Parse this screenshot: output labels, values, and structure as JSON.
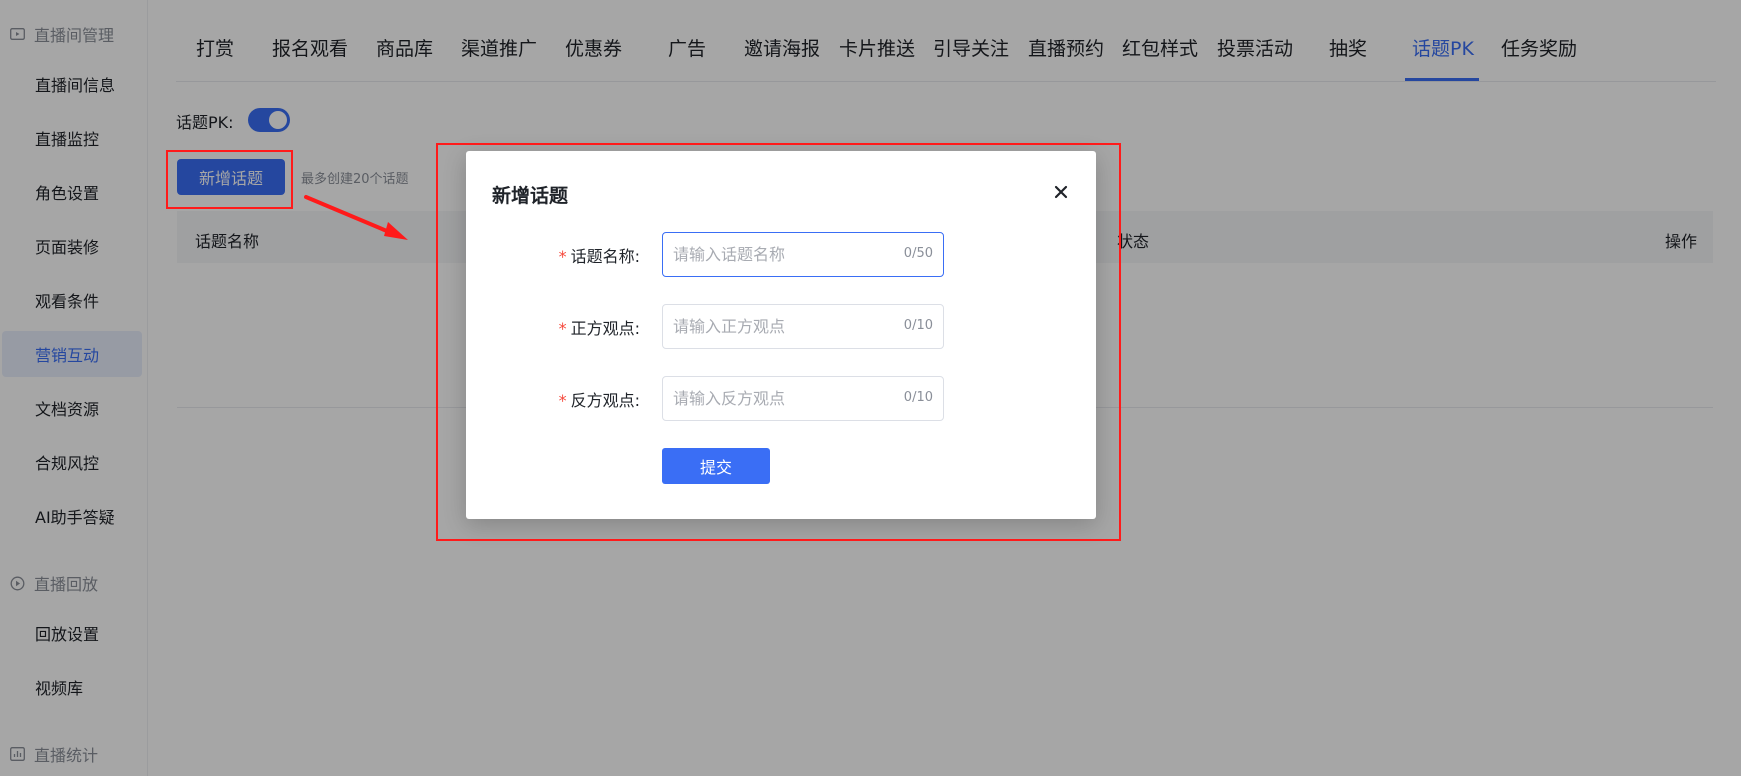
{
  "sidebar": {
    "groups": [
      {
        "label": "直播间管理",
        "icon": "live-room-icon"
      },
      {
        "label": "直播回放",
        "icon": "replay-icon"
      },
      {
        "label": "直播统计",
        "icon": "stats-icon"
      }
    ],
    "items": [
      {
        "label": "直播间信息"
      },
      {
        "label": "直播监控"
      },
      {
        "label": "角色设置"
      },
      {
        "label": "页面装修"
      },
      {
        "label": "观看条件"
      },
      {
        "label": "营销互动"
      },
      {
        "label": "文档资源"
      },
      {
        "label": "合规风控"
      },
      {
        "label": "AI助手答疑"
      },
      {
        "label": "回放设置"
      },
      {
        "label": "视频库"
      }
    ],
    "active_item": "营销互动"
  },
  "tabs": [
    "打赏",
    "报名观看",
    "商品库",
    "渠道推广",
    "优惠券",
    "广告",
    "邀请海报",
    "卡片推送",
    "引导关注",
    "直播预约",
    "红包样式",
    "投票活动",
    "抽奖",
    "话题PK",
    "任务奖励"
  ],
  "active_tab": "话题PK",
  "content": {
    "pk_label": "话题PK:",
    "pk_enabled": true,
    "add_button": "新增话题",
    "add_hint": "最多创建20个话题",
    "table_headers": {
      "name": "话题名称",
      "status": "状态",
      "actions": "操作"
    }
  },
  "modal": {
    "title": "新增话题",
    "fields": [
      {
        "label": "话题名称:",
        "placeholder": "请输入话题名称",
        "value": "",
        "count": "0/50"
      },
      {
        "label": "正方观点:",
        "placeholder": "请输入正方观点",
        "value": "",
        "count": "0/10"
      },
      {
        "label": "反方观点:",
        "placeholder": "请输入反方观点",
        "value": "",
        "count": "0/10"
      }
    ],
    "required_mark": "*",
    "submit": "提交"
  },
  "colors": {
    "accent": "#3a6ef5",
    "highlight": "#ff1a1a",
    "required": "#f5483b"
  }
}
